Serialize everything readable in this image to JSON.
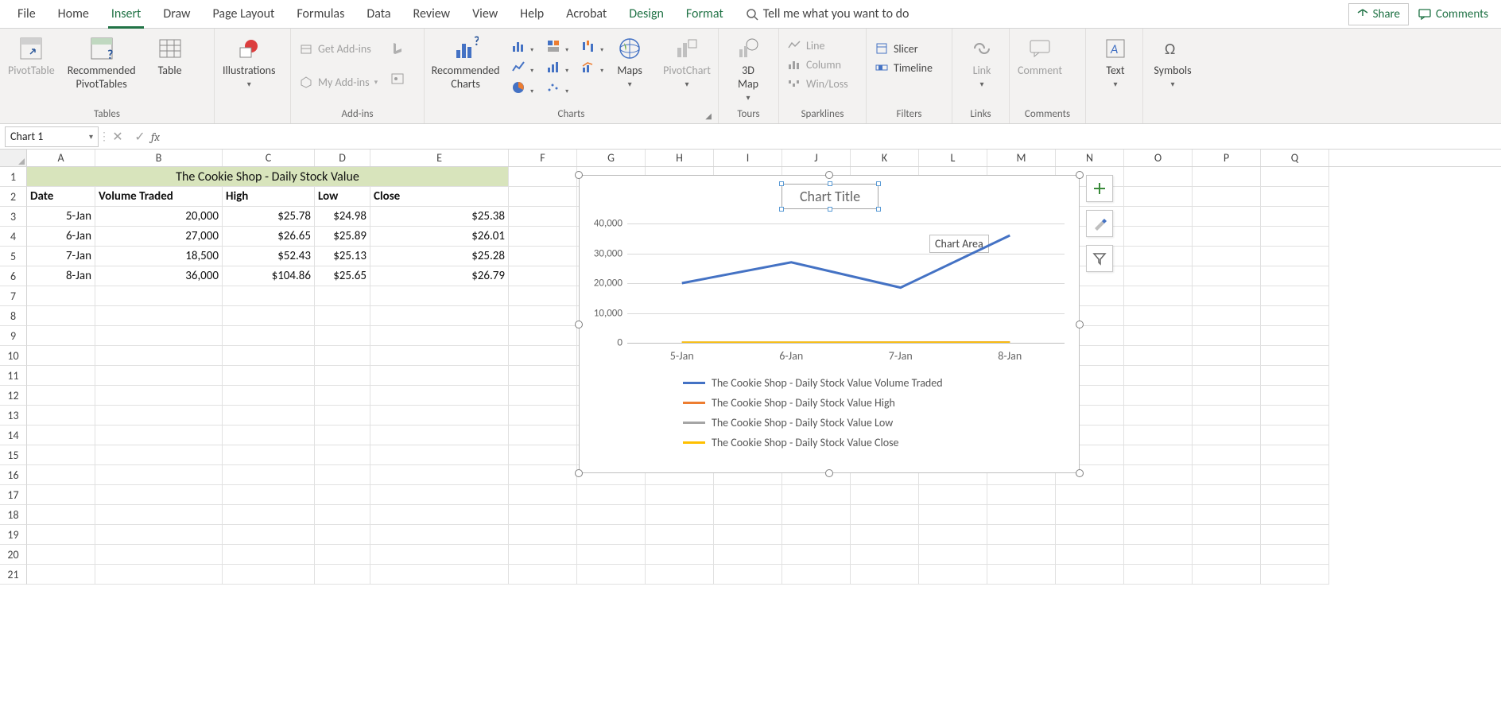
{
  "tabs": {
    "file": "File",
    "home": "Home",
    "insert": "Insert",
    "draw": "Draw",
    "page_layout": "Page Layout",
    "formulas": "Formulas",
    "data": "Data",
    "review": "Review",
    "view": "View",
    "help": "Help",
    "acrobat": "Acrobat",
    "design": "Design",
    "format": "Format"
  },
  "tell_me": "Tell me what you want to do",
  "share": "Share",
  "comments": "Comments",
  "ribbon": {
    "tables": {
      "label": "Tables",
      "pivot": "PivotTable",
      "rec_pivot": "Recommended\nPivotTables",
      "table": "Table"
    },
    "illustrations": {
      "label": "Illustrations",
      "btn": "Illustrations"
    },
    "addins": {
      "label": "Add-ins",
      "get": "Get Add-ins",
      "my": "My Add-ins"
    },
    "charts": {
      "label": "Charts",
      "rec": "Recommended\nCharts",
      "maps": "Maps",
      "pivotchart": "PivotChart"
    },
    "tours": {
      "label": "Tours",
      "map3d": "3D\nMap"
    },
    "sparklines": {
      "label": "Sparklines",
      "line": "Line",
      "column": "Column",
      "winloss": "Win/Loss"
    },
    "filters": {
      "label": "Filters",
      "slicer": "Slicer",
      "timeline": "Timeline"
    },
    "links": {
      "label": "Links",
      "link": "Link"
    },
    "comments_grp": {
      "label": "Comments",
      "comment": "Comment"
    },
    "text": {
      "label": "Text",
      "btn": "Text"
    },
    "symbols": {
      "label": "Symbols",
      "btn": "Symbols"
    }
  },
  "name_box": "Chart 1",
  "columns": [
    "A",
    "B",
    "C",
    "D",
    "E",
    "F",
    "G",
    "H",
    "I",
    "J",
    "K",
    "L",
    "M",
    "N",
    "O",
    "P",
    "Q"
  ],
  "title_row": "The Cookie Shop - Daily Stock Value",
  "headers": {
    "date": "Date",
    "volume": "Volume Traded",
    "high": "High",
    "low": "Low",
    "close": "Close"
  },
  "rows": [
    {
      "date": "5-Jan",
      "volume": "20,000",
      "high": "$25.78",
      "low": "$24.98",
      "close": "$25.38"
    },
    {
      "date": "6-Jan",
      "volume": "27,000",
      "high": "$26.65",
      "low": "$25.89",
      "close": "$26.01"
    },
    {
      "date": "7-Jan",
      "volume": "18,500",
      "high": "$52.43",
      "low": "$25.13",
      "close": "$25.28"
    },
    {
      "date": "8-Jan",
      "volume": "36,000",
      "high": "$104.86",
      "low": "$25.65",
      "close": "$26.79"
    }
  ],
  "chart": {
    "title": "Chart Title",
    "tooltip": "Chart Area",
    "yticks": [
      "40,000",
      "30,000",
      "20,000",
      "10,000",
      "0"
    ],
    "xticks": [
      "5-Jan",
      "6-Jan",
      "7-Jan",
      "8-Jan"
    ],
    "legend": [
      {
        "color": "#4472c4",
        "label": "The Cookie Shop - Daily Stock Value Volume Traded"
      },
      {
        "color": "#ed7d31",
        "label": "The Cookie Shop - Daily Stock Value High"
      },
      {
        "color": "#a5a5a5",
        "label": "The Cookie Shop - Daily Stock Value Low"
      },
      {
        "color": "#ffc000",
        "label": "The Cookie Shop - Daily Stock Value Close"
      }
    ]
  },
  "chart_data": {
    "type": "line",
    "title": "Chart Title",
    "categories": [
      "5-Jan",
      "6-Jan",
      "7-Jan",
      "8-Jan"
    ],
    "ylim": [
      0,
      40000
    ],
    "xlabel": "",
    "ylabel": "",
    "series": [
      {
        "name": "The Cookie Shop - Daily Stock Value Volume Traded",
        "color": "#4472c4",
        "values": [
          20000,
          27000,
          18500,
          36000
        ]
      },
      {
        "name": "The Cookie Shop - Daily Stock Value High",
        "color": "#ed7d31",
        "values": [
          25.78,
          26.65,
          52.43,
          104.86
        ]
      },
      {
        "name": "The Cookie Shop - Daily Stock Value Low",
        "color": "#a5a5a5",
        "values": [
          24.98,
          25.89,
          25.13,
          25.65
        ]
      },
      {
        "name": "The Cookie Shop - Daily Stock Value Close",
        "color": "#ffc000",
        "values": [
          25.38,
          26.01,
          25.28,
          26.79
        ]
      }
    ]
  }
}
